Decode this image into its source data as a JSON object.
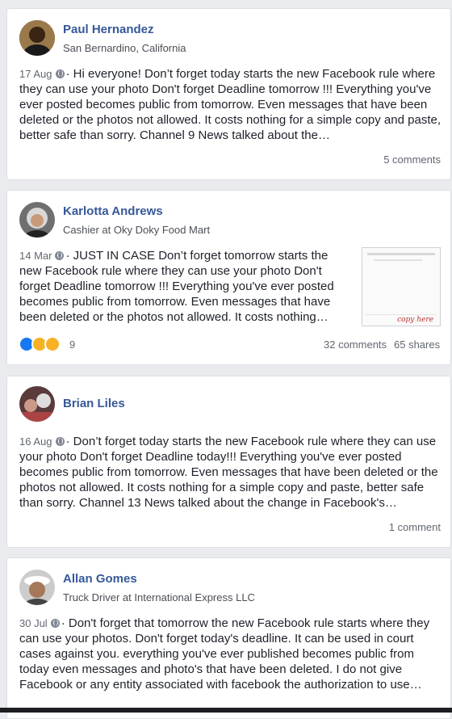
{
  "posts": [
    {
      "name": "Paul Hernandez",
      "subtitle": "San Bernardino, California",
      "date": "17 Aug",
      "text": "Hi everyone! Don’t forget today starts the new Facebook rule where they can use your photo Don't forget Deadline tomorrow !!! Everything you've ever posted becomes public from tomorrow. Even messages that have been deleted or the photos not allowed. It costs nothing for a simple copy and paste, better safe than sorry. Channel 9 News talked about the…",
      "comments": "5 comments"
    },
    {
      "name": "Karlotta Andrews",
      "subtitle": "Cashier at Oky Doky Food Mart",
      "date": "14 Mar",
      "text": "JUST IN CASE Don’t forget tomorrow starts the new Facebook rule where they can use your photo Don't forget Deadline tomorrow !!! Everything you've ever posted becomes public from tomorrow. Even messages that have been deleted or the photos not allowed. It costs nothing…",
      "reaction_count": "9",
      "comments": "32 comments",
      "shares": "65 shares",
      "thumb_text": "copy here"
    },
    {
      "name": "Brian Liles",
      "date": "16 Aug",
      "text": "Don’t forget today starts the new Facebook rule where they can use your photo Don't forget Deadline today!!! Everything you've ever posted becomes public from tomorrow. Even messages that have been deleted or the photos not allowed. It costs nothing for a simple copy and paste, better safe than sorry. Channel 13 News talked about the change in Facebook's…",
      "comments": "1 comment"
    },
    {
      "name": "Allan Gomes",
      "subtitle": "Truck Driver at International Express LLC",
      "date": "30 Jul",
      "text": "Don't forget that tomorrow the new Facebook rule starts where they can use your photos. Don't forget today's deadline. It can be used in court cases against you. everything you've ever published becomes public from today even messages and photo's that have been deleted. I do not give Facebook or any entity associated with facebook the authorization to use…"
    }
  ],
  "colors": {
    "name": "#365899",
    "background": "#e9ebee",
    "like": "#1877f2",
    "haha": "#f7b125"
  }
}
